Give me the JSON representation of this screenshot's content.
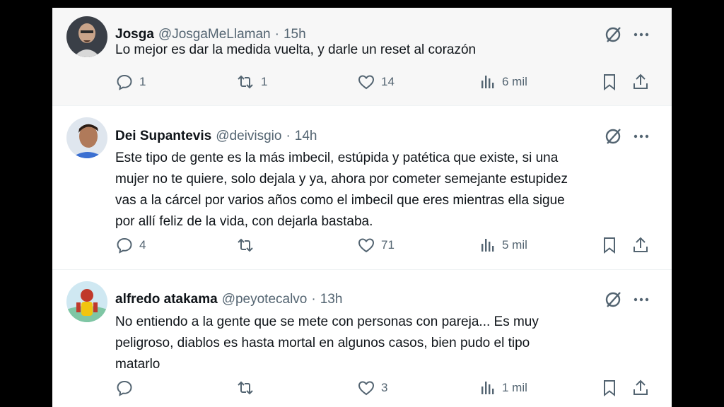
{
  "tweets": [
    {
      "name": "Josga",
      "handle": "@JosgaMeLlaman",
      "separator": "·",
      "time": "15h",
      "lines": [
        "Lo mejor es dar la medida vuelta, y darle un reset al corazón"
      ],
      "replies": "1",
      "retweets": "1",
      "likes": "14",
      "views": "6 mil"
    },
    {
      "name": "Dei Supantevis",
      "handle": "@deivisgio",
      "separator": "·",
      "time": "14h",
      "lines": [
        "Este tipo de gente es la más imbecil, estúpida y patética que existe, si una",
        "mujer no te quiere, solo dejala y ya, ahora por cometer semejante estupidez",
        "vas a la cárcel por varios años como el imbecil que eres mientras ella sigue",
        "por allí feliz de la vida, con dejarla bastaba."
      ],
      "replies": "4",
      "retweets": "",
      "likes": "71",
      "views": "5 mil"
    },
    {
      "name": "alfredo atakama",
      "handle": "@peyotecalvo",
      "separator": "·",
      "time": "13h",
      "lines": [
        "No entiendo a la gente que se mete con personas con pareja... Es muy",
        "peligroso, diablos es hasta mortal en algunos casos, bien pudo el tipo",
        "matarlo"
      ],
      "replies": "",
      "retweets": "",
      "likes": "3",
      "views": "1 mil"
    }
  ],
  "icons": {
    "top": [
      "grok-icon",
      "more-icon"
    ],
    "actions": [
      "reply-icon",
      "retweet-icon",
      "like-icon",
      "views-icon",
      "bookmark-icon",
      "share-icon"
    ]
  },
  "colors": {
    "text": "#0f1419",
    "muted": "#536471",
    "highlight_bg": "#f7f7f7"
  }
}
